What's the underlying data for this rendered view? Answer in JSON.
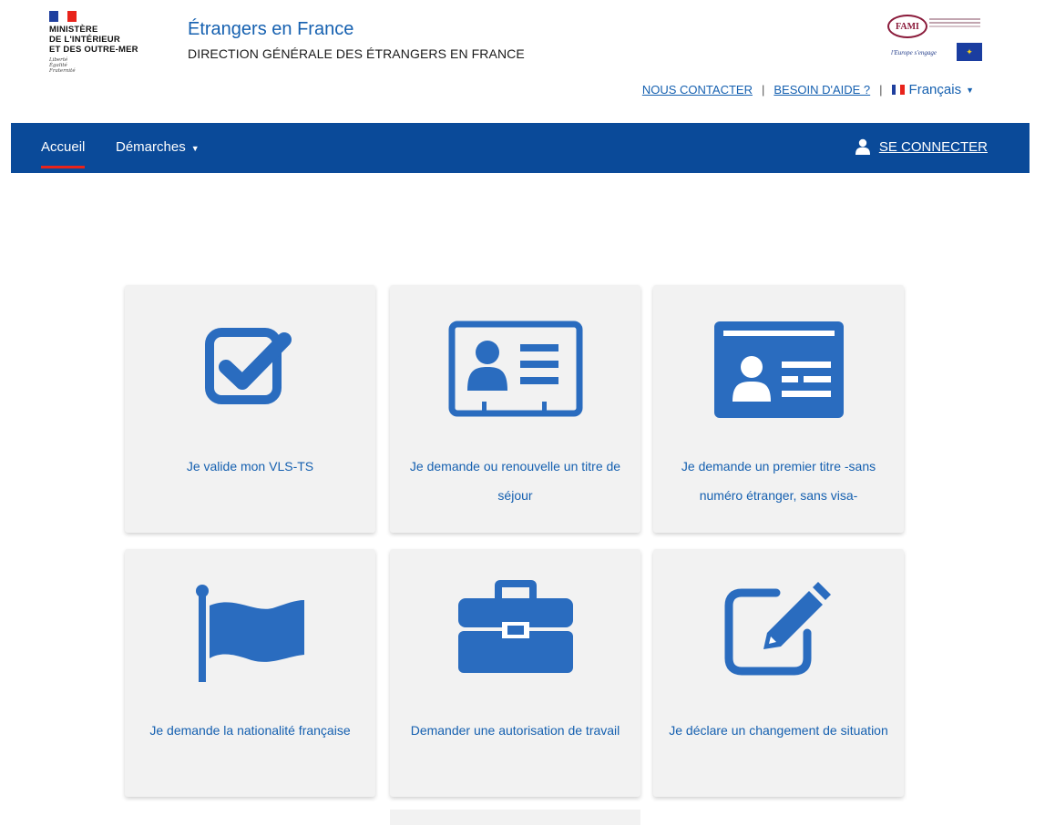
{
  "colors": {
    "primary": "#1560b0",
    "navbar": "#0a4a99",
    "active_underline": "#e8231b",
    "tile_bg": "#f2f2f2",
    "icon": "#2a6cbf"
  },
  "header": {
    "gov_logo": {
      "lines": [
        "MINISTÈRE",
        "DE L'INTÉRIEUR",
        "ET DES OUTRE-MER"
      ],
      "motto": [
        "Liberté",
        "Égalité",
        "Fraternité"
      ]
    },
    "site_title": "Étrangers en France",
    "site_subtitle": "DIRECTION GÉNÉRALE DES ÉTRANGERS EN FRANCE",
    "fami": {
      "badge": "FAMI",
      "tagline": "l'Europe s'engage"
    },
    "util_nav": {
      "contact": "NOUS CONTACTER",
      "separator": "|",
      "help": "BESOIN D'AIDE ?",
      "language": "Français"
    }
  },
  "navbar": {
    "home": "Accueil",
    "procedures": "Démarches",
    "login": "SE CONNECTER",
    "login_icon": "user-icon"
  },
  "tiles": [
    {
      "label": "Je valide mon VLS-TS",
      "icon": "checkbox-icon"
    },
    {
      "label": "Je demande ou renouvelle un titre de séjour",
      "icon": "id-badge-icon"
    },
    {
      "label": "Je demande un premier titre -sans numéro étranger, sans visa-",
      "icon": "id-card-icon"
    },
    {
      "label": "Je demande la nationalité française",
      "icon": "flag-icon"
    },
    {
      "label": "Demander une autorisation de travail",
      "icon": "briefcase-icon"
    },
    {
      "label": "Je déclare un changement de situation",
      "icon": "edit-icon"
    }
  ]
}
